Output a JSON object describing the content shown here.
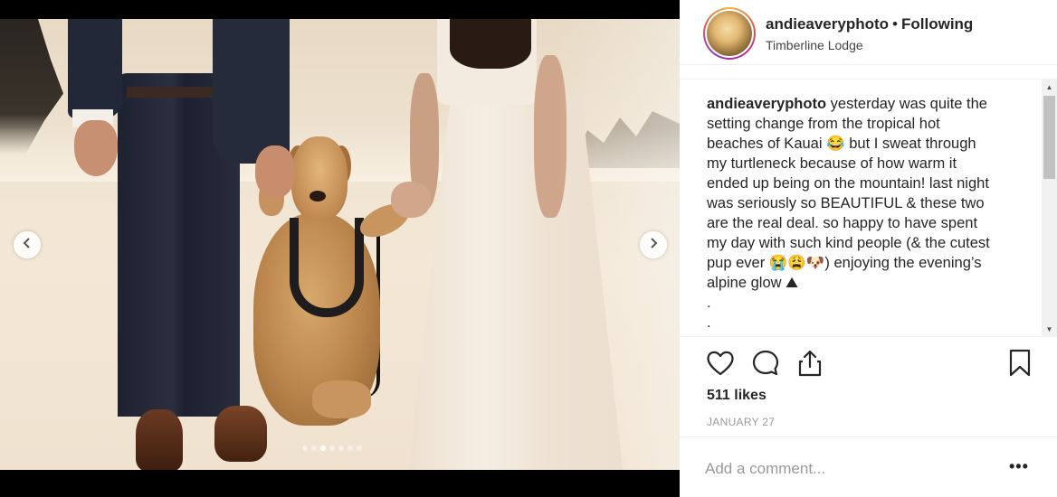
{
  "post": {
    "username": "andieaveryphoto",
    "separator": "•",
    "follow_status": "Following",
    "location": "Timberline Lodge",
    "caption_user": "andieaveryphoto",
    "caption_lines": [
      " yesterday was quite the",
      "setting change from the tropical hot",
      "beaches of Kauai 😂 but I sweat through",
      "my turtleneck because of how warm it",
      "ended up being on the mountain! last night",
      "was seriously so BEAUTIFUL & these two",
      "are the real deal. so happy to have spent",
      "my day with such kind people (& the cutest",
      "pup ever 😭😩🐶) enjoying the evening’s",
      "alpine glow ⛰"
    ],
    "caption_dots": [
      ".",
      "."
    ],
    "likes": "511 likes",
    "date": "JANUARY 27",
    "comment_placeholder": "Add a comment...",
    "more": "•••"
  },
  "carousel": {
    "prev_icon": "chevron-left-icon",
    "next_icon": "chevron-right-icon",
    "total": 7,
    "active_index": 2
  },
  "icons": {
    "like": "heart-icon",
    "comment": "comment-bubble-icon",
    "share": "share-icon",
    "save": "bookmark-icon"
  },
  "scrollbar": {
    "up": "▲",
    "down": "▼"
  }
}
